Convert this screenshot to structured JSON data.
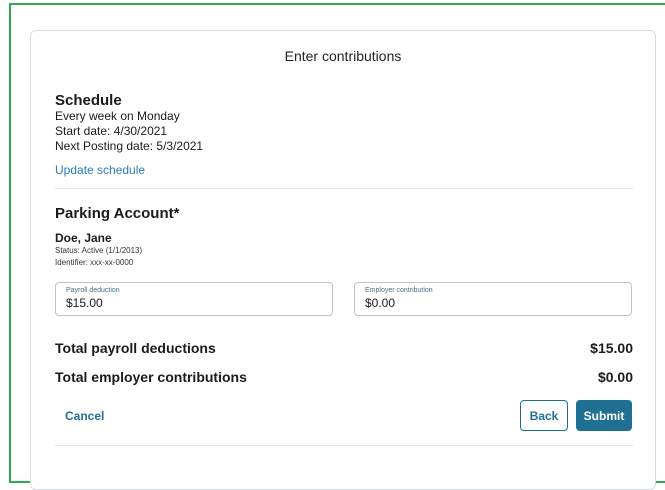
{
  "header": {
    "title": "Enter contributions"
  },
  "schedule": {
    "heading": "Schedule",
    "frequency": "Every week on Monday",
    "start_date": "Start date: 4/30/2021",
    "next_posting": "Next Posting date: 5/3/2021",
    "update_link": "Update schedule"
  },
  "account": {
    "heading": "Parking Account*",
    "person_name": "Doe, Jane",
    "status": "Status: Active (1/1/2013)",
    "identifier": "Identifier: xxx-xx-0000"
  },
  "fields": {
    "payroll_label": "Payroll deduction",
    "payroll_value": "$15.00",
    "employer_label": "Employer contribution",
    "employer_value": "$0.00"
  },
  "totals": {
    "payroll_label": "Total payroll deductions",
    "payroll_amount": "$15.00",
    "employer_label": "Total employer contributions",
    "employer_amount": "$0.00"
  },
  "actions": {
    "cancel": "Cancel",
    "back": "Back",
    "submit": "Submit"
  },
  "colors": {
    "frame_border": "#2fa84f",
    "link": "#2a7bc0",
    "primary": "#1f6f93"
  }
}
